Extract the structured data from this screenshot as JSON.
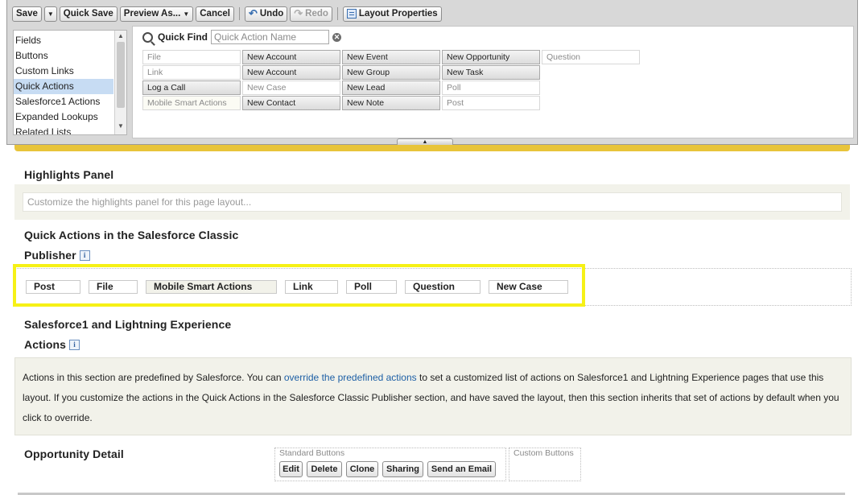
{
  "toolbar": {
    "save": "Save",
    "quick_save": "Quick Save",
    "preview_as": "Preview As...",
    "cancel": "Cancel",
    "undo": "Undo",
    "redo": "Redo",
    "layout_properties": "Layout Properties"
  },
  "palette": {
    "categories": [
      "Fields",
      "Buttons",
      "Custom Links",
      "Quick Actions",
      "Salesforce1 Actions",
      "Expanded Lookups",
      "Related Lists"
    ],
    "selected_category": "Quick Actions",
    "quick_find": {
      "label": "Quick Find",
      "placeholder": "Quick Action Name"
    },
    "actions_grid": [
      [
        {
          "label": "File",
          "state": "used"
        },
        {
          "label": "New Account",
          "state": "available"
        },
        {
          "label": "New Event",
          "state": "available"
        },
        {
          "label": "New Opportunity",
          "state": "available"
        },
        {
          "label": "Question",
          "state": "used"
        }
      ],
      [
        {
          "label": "Link",
          "state": "used"
        },
        {
          "label": "New Account",
          "state": "available"
        },
        {
          "label": "New Group",
          "state": "available"
        },
        {
          "label": "New Task",
          "state": "available"
        },
        {
          "label": "",
          "state": "empty"
        }
      ],
      [
        {
          "label": "Log a Call",
          "state": "available"
        },
        {
          "label": "New Case",
          "state": "used"
        },
        {
          "label": "New Lead",
          "state": "available"
        },
        {
          "label": "Poll",
          "state": "used"
        },
        {
          "label": "",
          "state": "empty"
        }
      ],
      [
        {
          "label": "Mobile Smart Actions",
          "state": "used-highlight"
        },
        {
          "label": "New Contact",
          "state": "available"
        },
        {
          "label": "New Note",
          "state": "available"
        },
        {
          "label": "Post",
          "state": "used"
        },
        {
          "label": "",
          "state": "empty"
        }
      ]
    ]
  },
  "highlights": {
    "title": "Highlights Panel",
    "placeholder": "Customize the highlights panel for this page layout..."
  },
  "classic_publisher": {
    "title_line1": "Quick Actions in the Salesforce Classic",
    "title_line2": "Publisher",
    "info": "i",
    "items": [
      {
        "label": "Post",
        "width": 68
      },
      {
        "label": "File",
        "width": 61
      },
      {
        "label": "Mobile Smart Actions",
        "width": 163
      },
      {
        "label": "Link",
        "width": 66
      },
      {
        "label": "Poll",
        "width": 63
      },
      {
        "label": "Question",
        "width": 94
      },
      {
        "label": "New Case",
        "width": 99
      }
    ]
  },
  "lightning_actions": {
    "title_line1": "Salesforce1 and Lightning Experience",
    "title_line2": "Actions",
    "info": "i",
    "text_before_link": "Actions in this section are predefined by Salesforce. You can ",
    "link_text": "override the predefined actions",
    "text_after_link": " to set a customized list of actions on Salesforce1 and Lightning Experience pages that use this layout. If you customize the actions in the Quick Actions in the Salesforce Classic Publisher section, and have saved the layout, then this section inherits that set of actions by default when you click to override."
  },
  "opportunity_detail": {
    "title": "Opportunity Detail",
    "standard_buttons_label": "Standard Buttons",
    "standard_buttons": [
      "Edit",
      "Delete",
      "Clone",
      "Sharing",
      "Send an Email"
    ],
    "custom_buttons_label": "Custom Buttons"
  },
  "colors": {
    "highlight_border": "#f6f116",
    "accent_strip": "#e8c43a",
    "link": "#1d5fa5",
    "selected_category": "#c7dcf3"
  }
}
